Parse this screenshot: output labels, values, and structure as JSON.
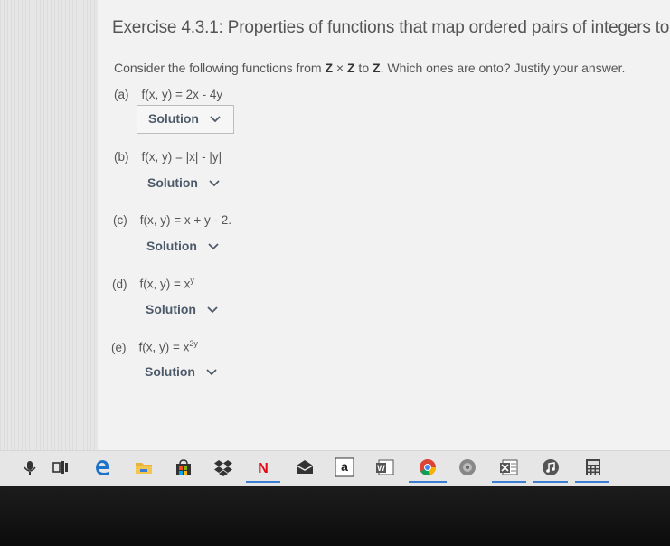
{
  "exercise": {
    "title": "Exercise 4.3.1: Properties of functions that map ordered pairs of integers to",
    "intro_before": "Consider the following functions from ",
    "set_z1": "Z",
    "times": " × ",
    "set_z2": "Z",
    "intro_to": " to ",
    "set_z3": "Z",
    "intro_after": ". Which ones are onto? Justify your answer.",
    "parts": [
      {
        "label": "(a)",
        "function": "f(x, y) = 2x - 4y",
        "solution": "Solution"
      },
      {
        "label": "(b)",
        "function": "f(x, y) = |x| - |y|",
        "solution": "Solution"
      },
      {
        "label": "(c)",
        "function": "f(x, y) = x + y - 2.",
        "solution": "Solution"
      },
      {
        "label": "(d)",
        "function_base": "f(x, y) = x",
        "function_exp": "y",
        "solution": "Solution"
      },
      {
        "label": "(e)",
        "function_base": "f(x, y) = x",
        "function_exp": "2y",
        "solution": "Solution"
      }
    ]
  },
  "taskbar": {
    "icons": [
      "microphone-icon",
      "task-view-icon",
      "edge-icon",
      "file-explorer-icon",
      "store-icon",
      "dropbox-icon",
      "netflix-icon",
      "mail-icon",
      "amazon-icon",
      "word-icon",
      "chrome-icon",
      "photos-icon",
      "excel-icon",
      "music-icon",
      "calculator-icon"
    ],
    "netflix_letter": "N",
    "amazon_letter": "a",
    "word_letter": "W"
  },
  "colors": {
    "accent_underline": "#3c7fd1",
    "solution_text": "#4d5a6a",
    "taskbar": "#e6e6e6"
  }
}
